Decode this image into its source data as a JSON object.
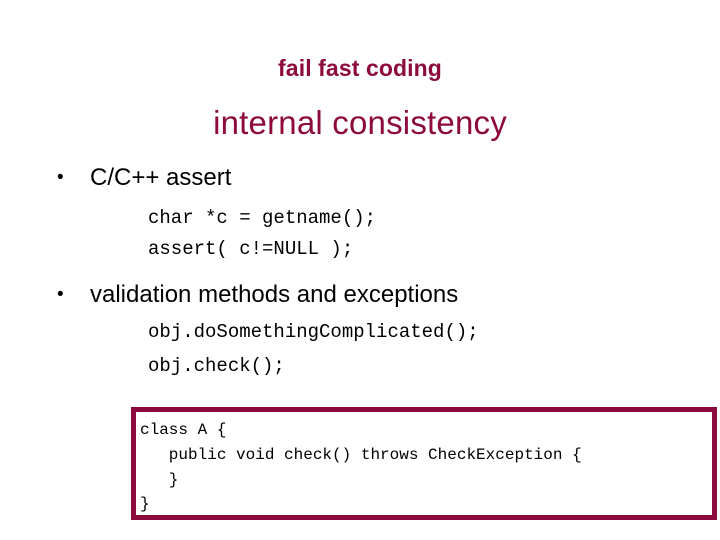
{
  "slide": {
    "background_color": "#ffffff",
    "accent_color": "#8c0a3c",
    "text_color": "#000000",
    "subtitle": "fail fast coding",
    "title": "internal consistency"
  },
  "bullets": [
    {
      "marker": "•",
      "label": "C/C++ assert"
    },
    {
      "marker": "•",
      "label": "validation methods and exceptions"
    }
  ],
  "code_snippets": {
    "group_a": [
      "char *c = getname();",
      "assert( c!=NULL );"
    ],
    "group_b": [
      "obj.doSomethingComplicated();",
      "obj.check();"
    ]
  },
  "code_box": {
    "border_color": "#8c0a3c",
    "lines": [
      "class A {",
      "   public void check() throws CheckException {",
      "   }",
      "}"
    ],
    "text": "class A {\n   public void check() throws CheckException {\n   }\n}"
  }
}
